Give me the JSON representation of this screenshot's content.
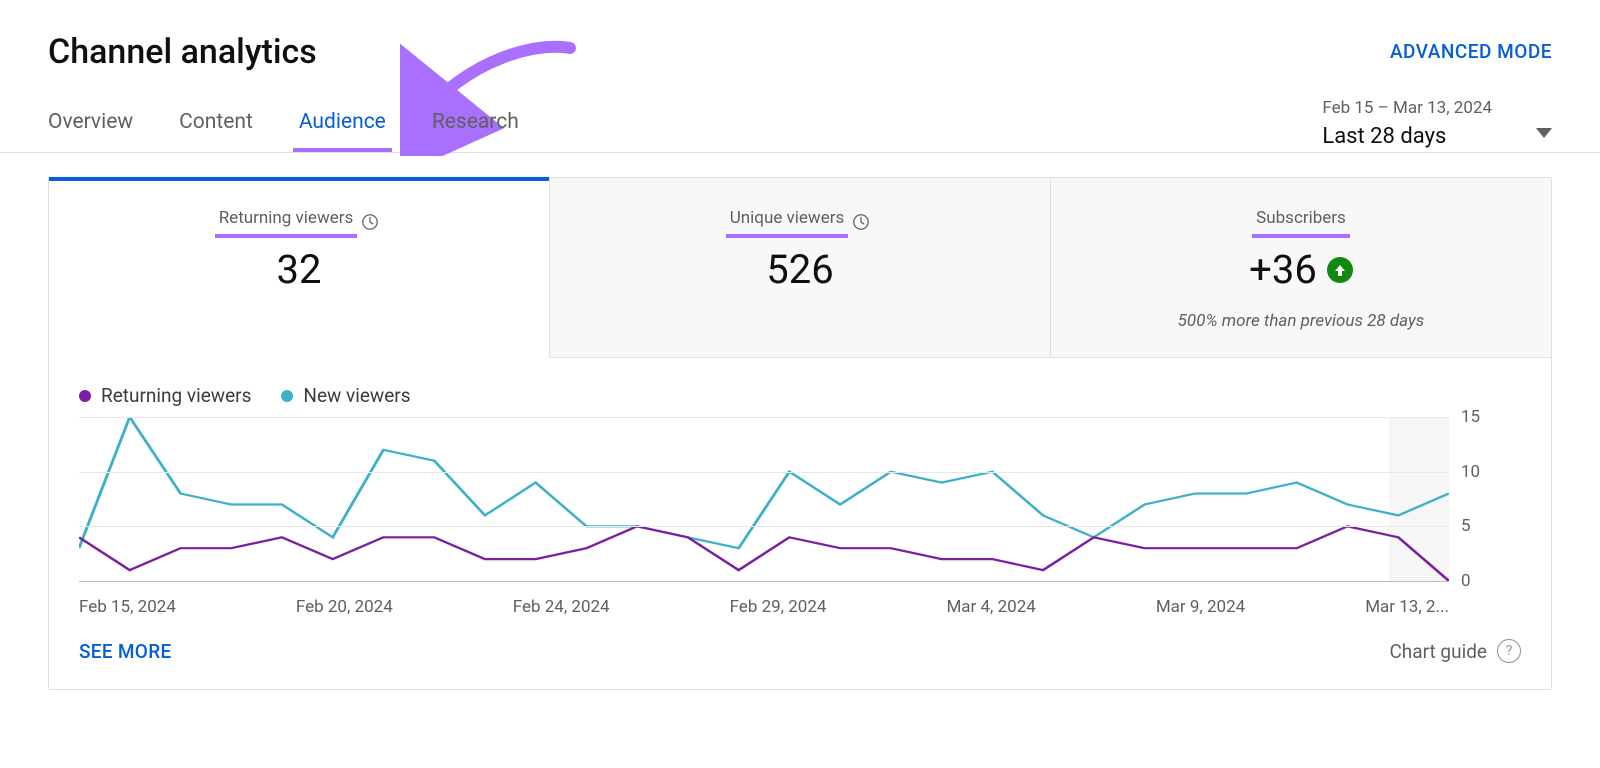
{
  "header": {
    "title": "Channel analytics",
    "advanced_mode": "ADVANCED MODE"
  },
  "date": {
    "range": "Feb 15 – Mar 13, 2024",
    "preset": "Last 28 days"
  },
  "tabs": {
    "overview": "Overview",
    "content": "Content",
    "audience": "Audience",
    "research": "Research",
    "active": "audience"
  },
  "metrics": {
    "returning": {
      "label": "Returning viewers",
      "value": "32"
    },
    "unique": {
      "label": "Unique viewers",
      "value": "526"
    },
    "subscribers": {
      "label": "Subscribers",
      "value": "+36",
      "delta_dir": "up",
      "sub": "500% more than previous 28 days"
    }
  },
  "legend": {
    "returning": "Returning viewers",
    "new": "New viewers"
  },
  "footer": {
    "see_more": "SEE MORE",
    "chart_guide": "Chart guide"
  },
  "colors": {
    "series_purple": "#7b1fa2",
    "series_teal": "#3eb0c9",
    "accent_purple": "#a970ff",
    "blue": "#065fd4",
    "green": "#0f8a0f"
  },
  "chart_data": {
    "type": "line",
    "xlabel": "",
    "ylabel": "",
    "ylim": [
      0,
      15
    ],
    "y_ticks": [
      0,
      5,
      10,
      15
    ],
    "x_tick_labels": [
      "Feb 15, 2024",
      "Feb 20, 2024",
      "Feb 24, 2024",
      "Feb 29, 2024",
      "Mar 4, 2024",
      "Mar 9, 2024",
      "Mar 13, 2..."
    ],
    "categories": [
      "Feb 15",
      "Feb 16",
      "Feb 17",
      "Feb 18",
      "Feb 19",
      "Feb 20",
      "Feb 21",
      "Feb 22",
      "Feb 23",
      "Feb 24",
      "Feb 25",
      "Feb 26",
      "Feb 27",
      "Feb 28",
      "Feb 29",
      "Mar 1",
      "Mar 2",
      "Mar 3",
      "Mar 4",
      "Mar 5",
      "Mar 6",
      "Mar 7",
      "Mar 8",
      "Mar 9",
      "Mar 10",
      "Mar 11",
      "Mar 12",
      "Mar 13"
    ],
    "series": [
      {
        "name": "Returning viewers",
        "color": "#7b1fa2",
        "values": [
          4,
          1,
          3,
          3,
          4,
          2,
          4,
          4,
          2,
          2,
          3,
          5,
          4,
          1,
          4,
          3,
          3,
          2,
          2,
          1,
          4,
          3,
          3,
          3,
          3,
          5,
          4,
          0
        ]
      },
      {
        "name": "New viewers",
        "color": "#3eb0c9",
        "values": [
          3,
          15,
          8,
          7,
          7,
          4,
          12,
          11,
          6,
          9,
          5,
          5,
          4,
          3,
          10,
          7,
          10,
          9,
          10,
          6,
          4,
          7,
          8,
          8,
          9,
          7,
          6,
          8
        ]
      }
    ]
  }
}
